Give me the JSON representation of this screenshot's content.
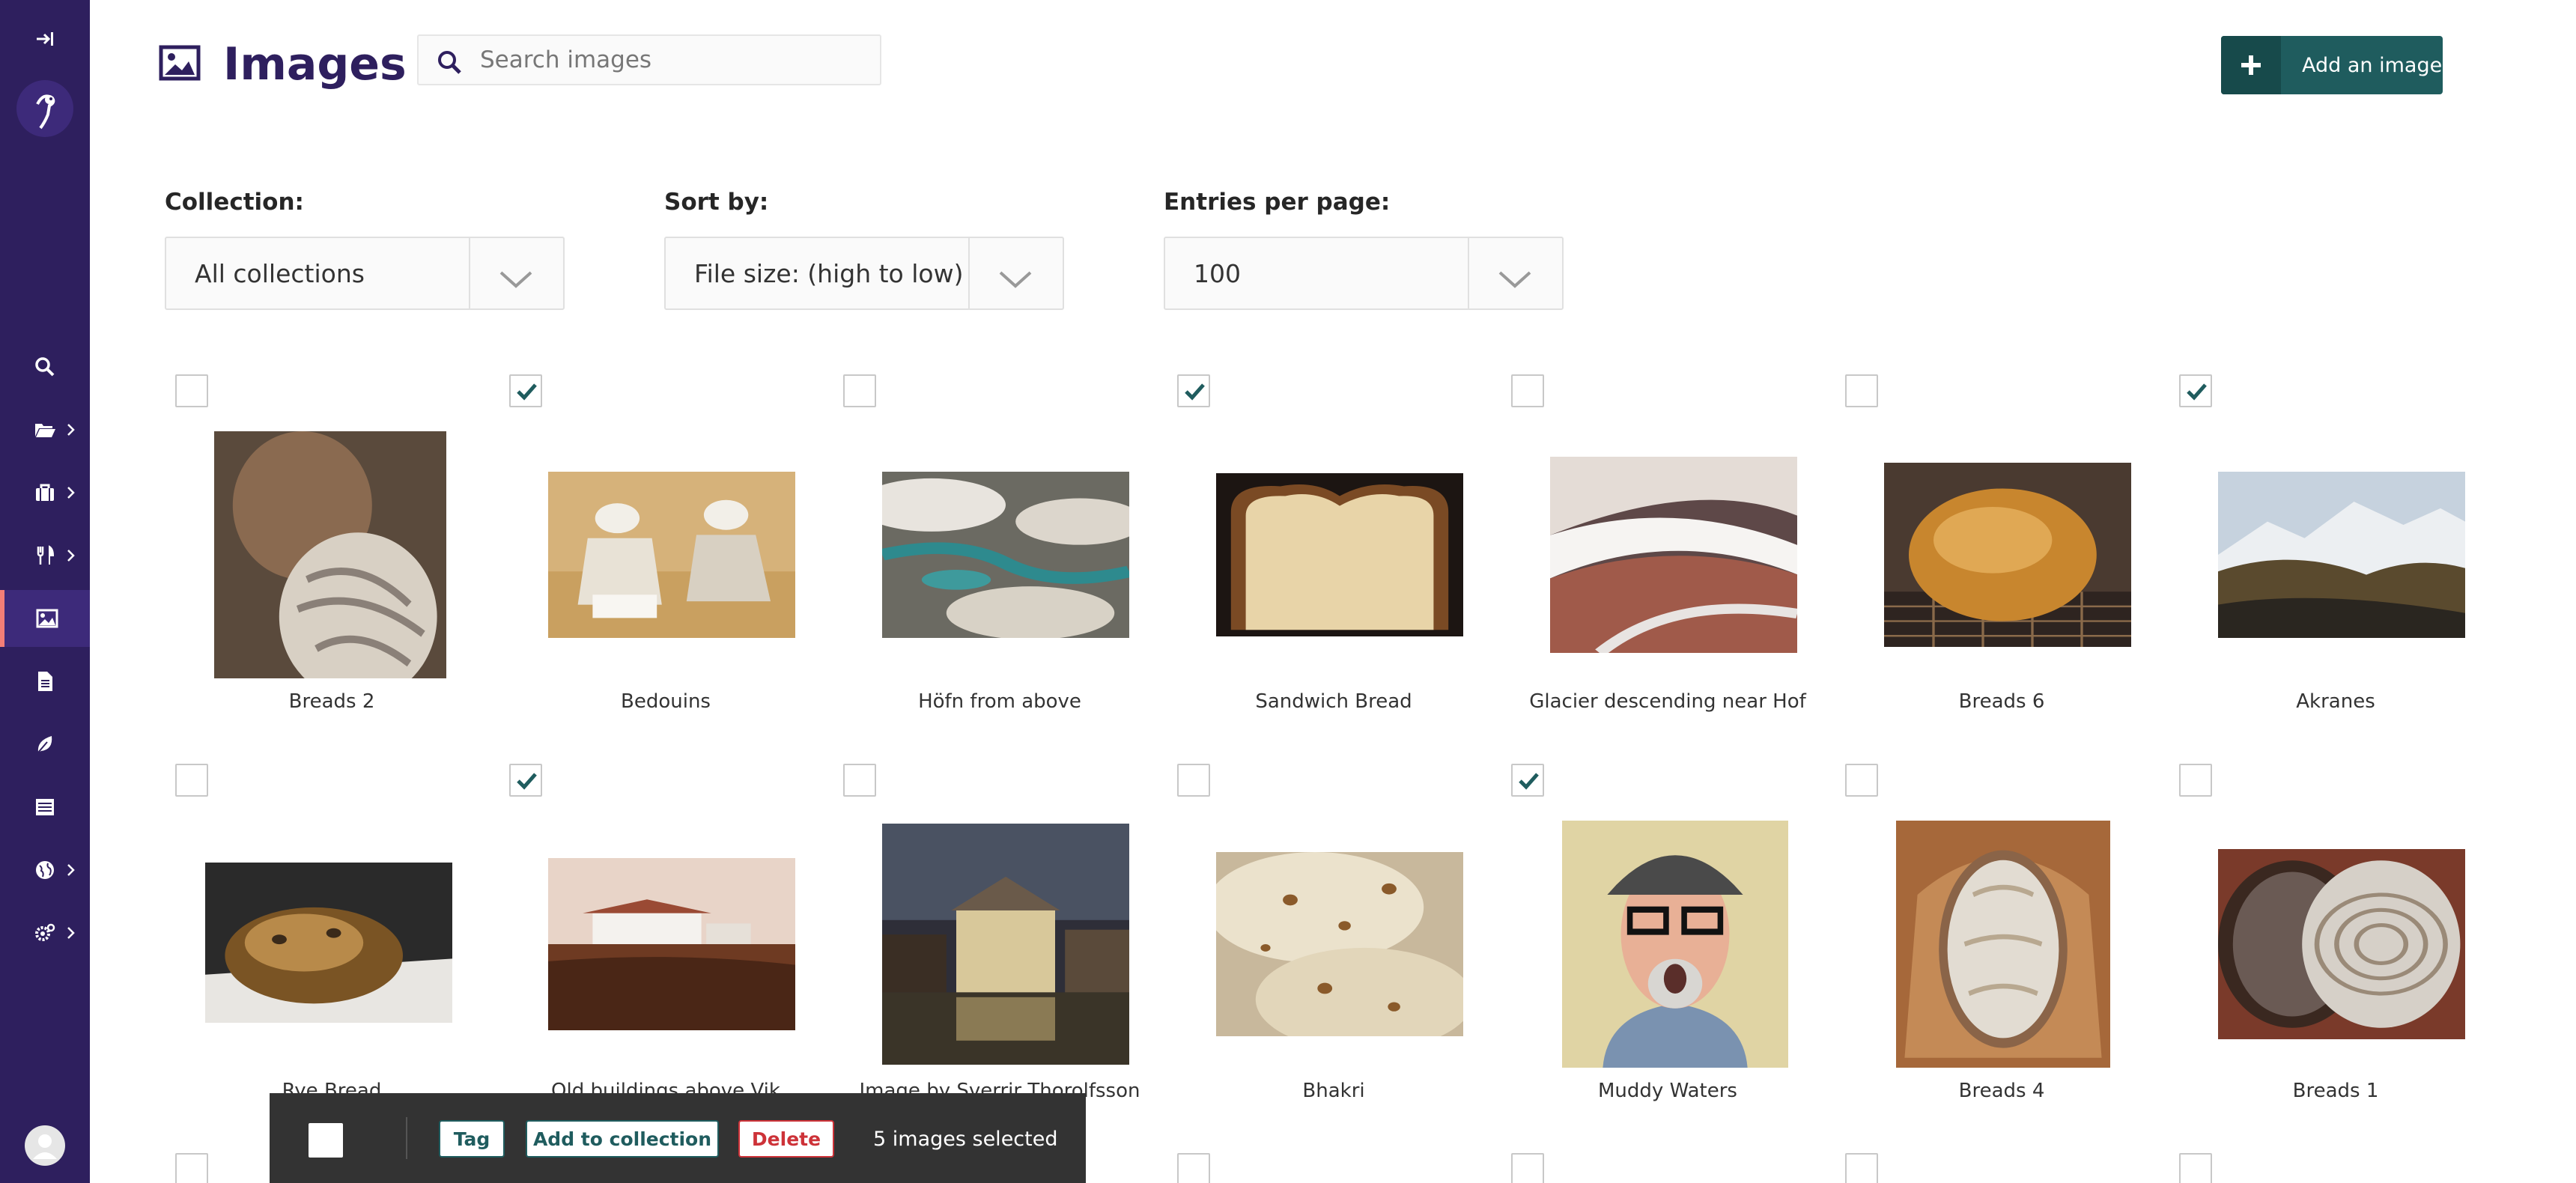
{
  "page": {
    "title": "Images"
  },
  "search": {
    "placeholder": "Search images",
    "value": ""
  },
  "header": {
    "add_label": "Add an image"
  },
  "filters": [
    {
      "label": "Collection:",
      "value": "All collections"
    },
    {
      "label": "Sort by:",
      "value": "File size: (high to low)"
    },
    {
      "label": "Entries per page:",
      "value": "100"
    }
  ],
  "images": [
    {
      "title": "Breads 2",
      "checked": false
    },
    {
      "title": "Bedouins",
      "checked": true
    },
    {
      "title": "Höfn from above",
      "checked": false
    },
    {
      "title": "Sandwich Bread",
      "checked": true
    },
    {
      "title": "Glacier descending near Hof",
      "checked": false
    },
    {
      "title": "Breads 6",
      "checked": false
    },
    {
      "title": "Akranes",
      "checked": true
    },
    {
      "title": "Rye Bread",
      "checked": false
    },
    {
      "title": "Old buildings above Vik",
      "checked": true
    },
    {
      "title": "Image by Sverrir Thorolfsson",
      "checked": false
    },
    {
      "title": "Bhakri",
      "checked": false
    },
    {
      "title": "Muddy Waters",
      "checked": true
    },
    {
      "title": "Breads 4",
      "checked": false
    },
    {
      "title": "Breads 1",
      "checked": false
    }
  ],
  "bulk": {
    "tag_label": "Tag",
    "add_to_collection_label": "Add to collection",
    "delete_label": "Delete",
    "selected_text": "5 images selected"
  },
  "colors": {
    "sidebar": "#2e1f5e",
    "sidebar_active_accent": "#f37e77",
    "primary": "#1f5c5e",
    "danger": "#cd3238",
    "title": "#2e1f5e"
  }
}
